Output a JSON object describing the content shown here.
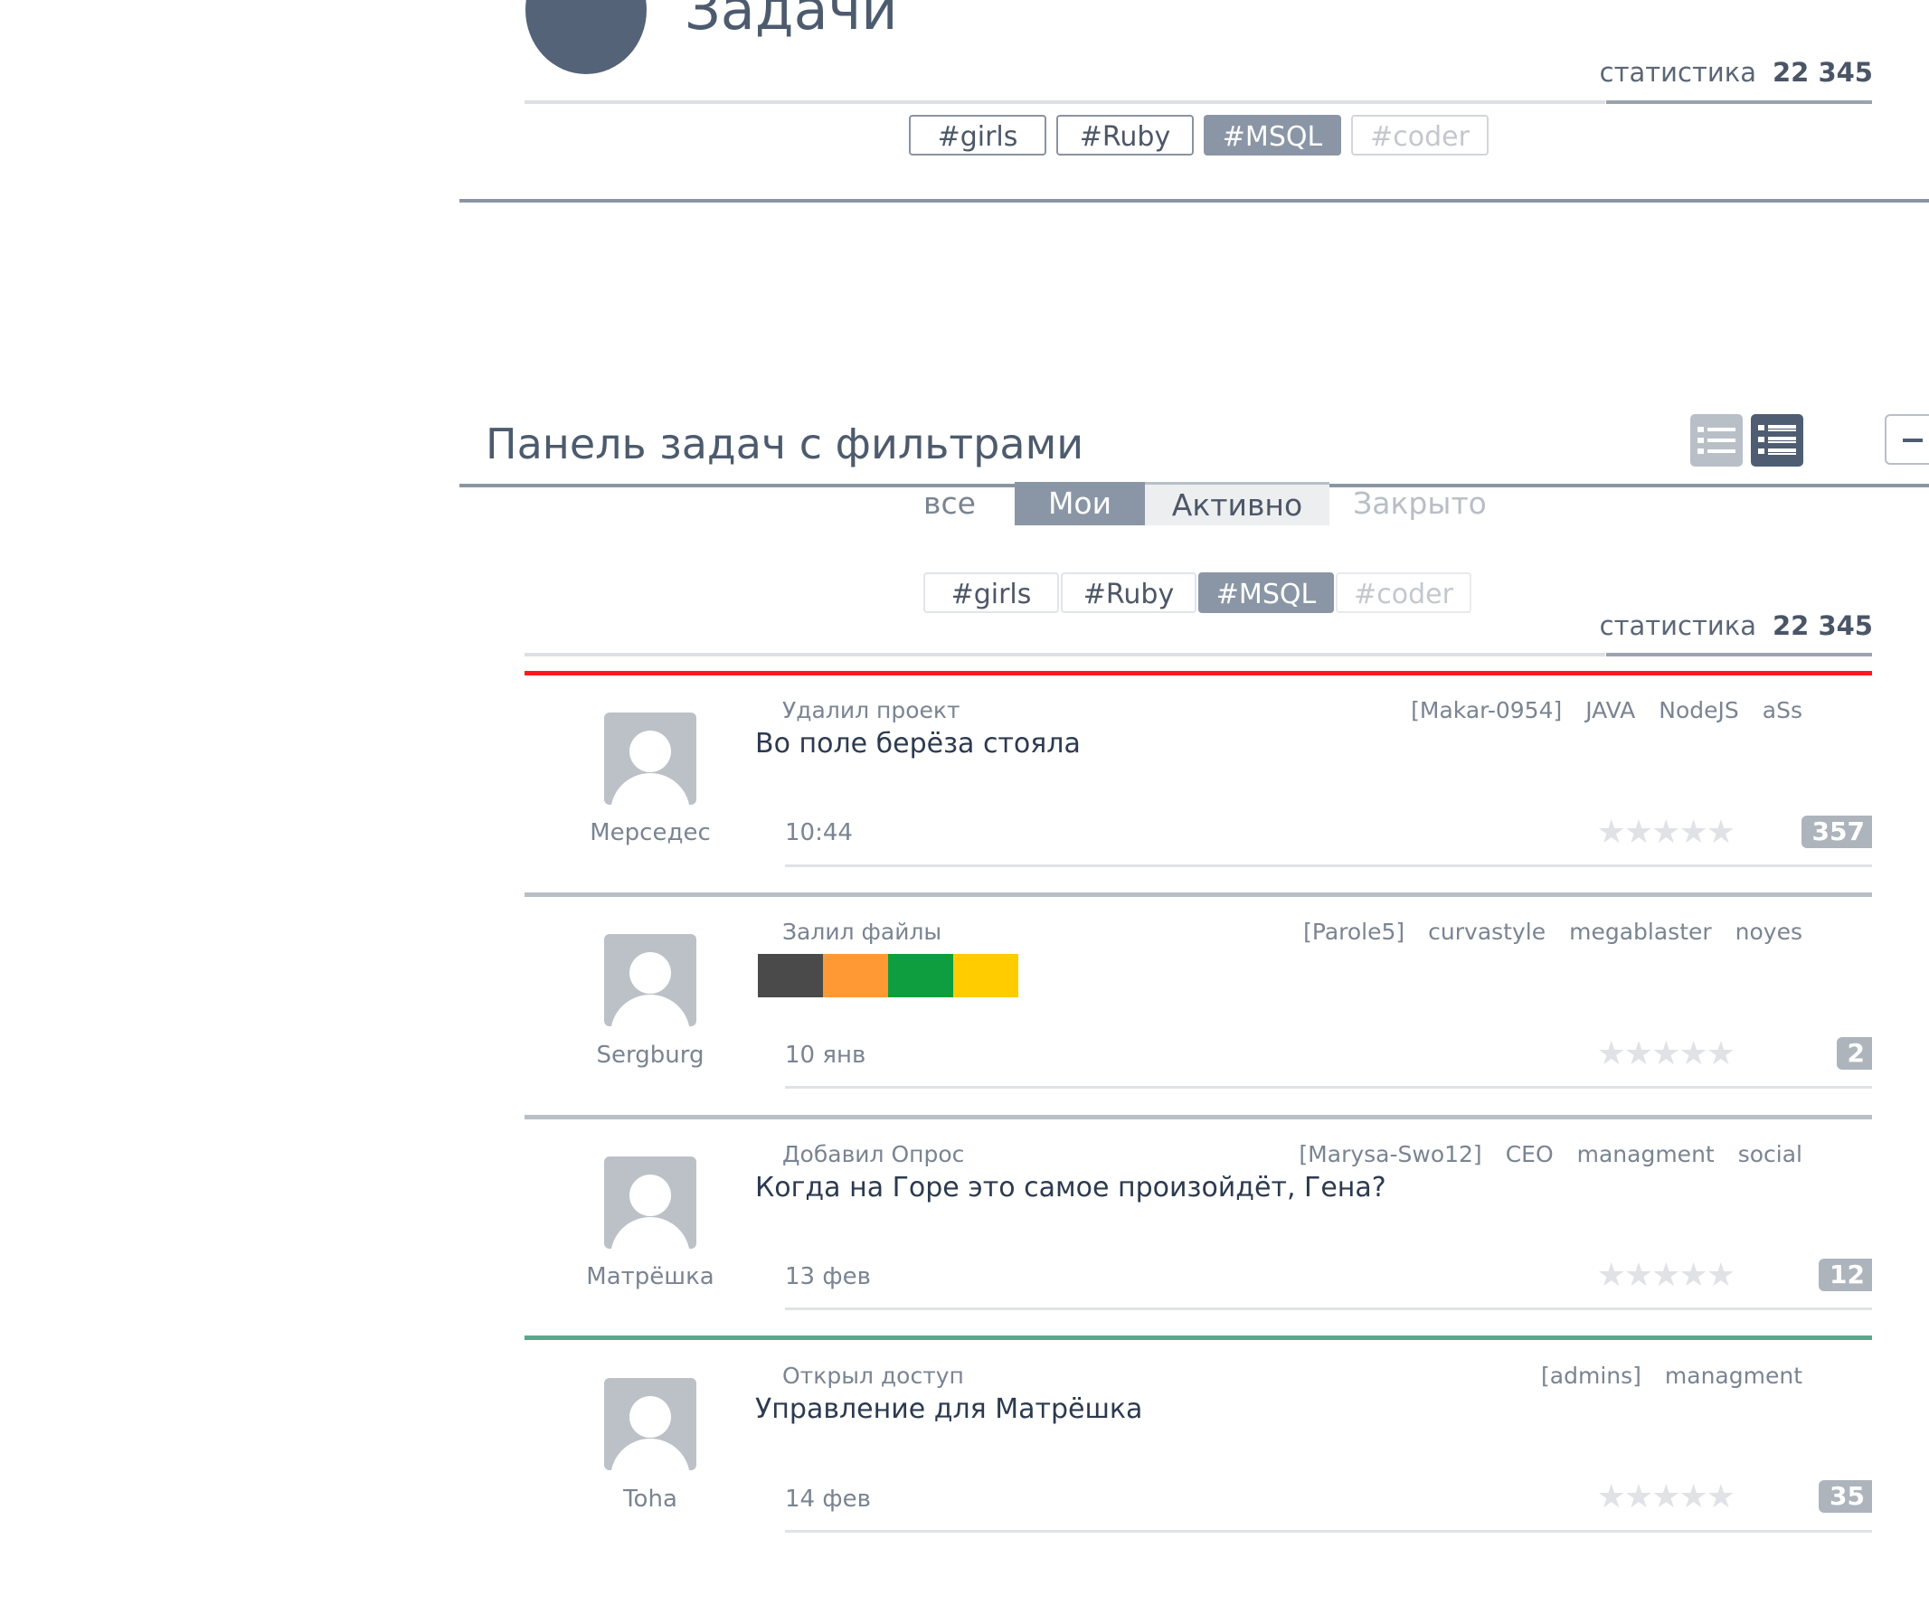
{
  "header": {
    "title": "Задачи",
    "stats": {
      "label": "статистика",
      "value": "22 345"
    },
    "tags": [
      "#girls",
      "#Ruby",
      "#MSQL",
      "#coder"
    ]
  },
  "panel": {
    "title": "Панель задач с фильтрами",
    "filter_tabs": [
      "все",
      "Мои",
      "Активно",
      "Закрыто"
    ],
    "tags": [
      "#girls",
      "#Ruby",
      "#MSQL",
      "#coder"
    ],
    "stats": {
      "label": "статистика",
      "value": "22 345"
    },
    "view_icons": [
      "list-icon",
      "detailed-list-icon"
    ],
    "collapse_icon": "minus-icon"
  },
  "feed": [
    {
      "author": "Мерседес",
      "action": "Удалил проект",
      "tags": [
        "[Makar-0954]",
        "JAVA",
        "NodeJS",
        "aSs"
      ],
      "text": "Во поле берёза стояла",
      "time": "10:44",
      "count": "357",
      "accent": "#ff1a1a"
    },
    {
      "author": "Sergburg",
      "action": "Залил файлы",
      "tags": [
        "[Parole5]",
        "curvastyle",
        "megablaster",
        "noyes"
      ],
      "swatches": [
        "#4a4a4a",
        "#ff9933",
        "#0f9e3f",
        "#ffcc00"
      ],
      "time": "10 янв",
      "count": "2",
      "accent": "#b9bfc7"
    },
    {
      "author": "Матрёшка",
      "action": "Добавил Опрос",
      "tags": [
        "[Marysa-Swo12]",
        "CEO",
        "managment",
        "social"
      ],
      "text": "Когда на Горе это самое произойдёт, Гена?",
      "time": "13 фев",
      "count": "12",
      "accent": "#b9bfc7"
    },
    {
      "author": "Toha",
      "action": "Открыл доступ",
      "tags": [
        "[admins]",
        "managment"
      ],
      "text": "Управление для Матрёшка",
      "time": "14 фев",
      "count": "35",
      "accent": "#5aa88a"
    }
  ],
  "rating_stars": "★★★★★"
}
